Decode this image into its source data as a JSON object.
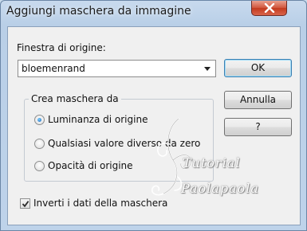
{
  "dialog": {
    "title": "Aggiungi maschera da immagine",
    "source_window_label": "Finestra di origine:",
    "source_window_value": "bloemenrand",
    "group_label": "Crea maschera da",
    "radio_options": [
      {
        "label": "Luminanza di origine",
        "checked": true
      },
      {
        "label": "Qualsiasi valore diverso da zero",
        "checked": false
      },
      {
        "label": "Opacità di origine",
        "checked": false
      }
    ],
    "invert_label": "Inverti i dati della maschera",
    "invert_checked": true
  },
  "buttons": {
    "ok": "OK",
    "cancel": "Annulla",
    "help": "?"
  },
  "watermark": {
    "line1": "Tutorial",
    "line2": "Paolapaola"
  }
}
